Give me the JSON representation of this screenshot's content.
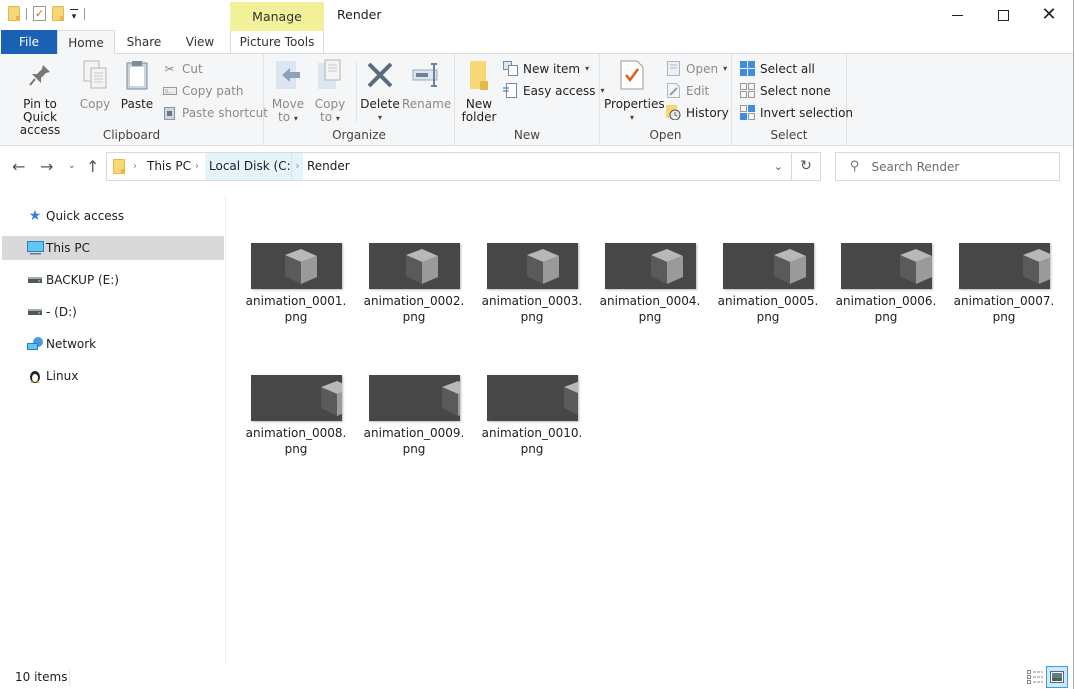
{
  "window": {
    "title": "Render",
    "contextual_tab_group": "Manage",
    "controls": {
      "minimize": "minimize",
      "maximize": "maximize",
      "close": "close"
    }
  },
  "quick_access_toolbar": {
    "items": [
      "folder-icon",
      "properties-icon",
      "new-folder-icon",
      "customize-dropdown"
    ]
  },
  "tabs": [
    {
      "label": "File",
      "active": false
    },
    {
      "label": "Home",
      "active": true
    },
    {
      "label": "Share",
      "active": false
    },
    {
      "label": "View",
      "active": false
    },
    {
      "label": "Picture Tools",
      "active": false
    }
  ],
  "ribbon": {
    "clipboard": {
      "label": "Clipboard",
      "pin": {
        "line1": "Pin to Quick",
        "line2": "access"
      },
      "copy": "Copy",
      "paste": "Paste",
      "cut": "Cut",
      "copy_path": "Copy path",
      "paste_shortcut": "Paste shortcut"
    },
    "organize": {
      "label": "Organize",
      "move_to": {
        "line1": "Move",
        "line2": "to"
      },
      "copy_to": {
        "line1": "Copy",
        "line2": "to"
      },
      "delete": "Delete",
      "rename": "Rename"
    },
    "new": {
      "label": "New",
      "new_folder": {
        "line1": "New",
        "line2": "folder"
      },
      "new_item": "New item",
      "easy_access": "Easy access"
    },
    "open": {
      "label": "Open",
      "properties": "Properties",
      "open": "Open",
      "edit": "Edit",
      "history": "History"
    },
    "select": {
      "label": "Select",
      "select_all": "Select all",
      "select_none": "Select none",
      "invert_selection": "Invert selection"
    }
  },
  "address_bar": {
    "crumbs": [
      "This PC",
      "Local Disk (C:)",
      "Render"
    ],
    "selected_crumb": "Local Disk (C:)"
  },
  "search": {
    "placeholder": "Search Render"
  },
  "nav_pane": {
    "items": [
      {
        "label": "Quick access",
        "icon": "star-icon"
      },
      {
        "label": "This PC",
        "icon": "computer-icon",
        "selected": true
      },
      {
        "label": "BACKUP (E:)",
        "icon": "drive-icon"
      },
      {
        "label": "- (D:)",
        "icon": "drive-icon"
      },
      {
        "label": "Network",
        "icon": "network-icon"
      },
      {
        "label": "Linux",
        "icon": "linux-icon"
      }
    ]
  },
  "files": [
    {
      "name": "animation_0001.png",
      "line1": "animation_0001.",
      "line2": "png",
      "cube_pos": 0.55
    },
    {
      "name": "animation_0002.png",
      "line1": "animation_0002.",
      "line2": "png",
      "cube_pos": 0.58
    },
    {
      "name": "animation_0003.png",
      "line1": "animation_0003.",
      "line2": "png",
      "cube_pos": 0.62
    },
    {
      "name": "animation_0004.png",
      "line1": "animation_0004.",
      "line2": "png",
      "cube_pos": 0.68
    },
    {
      "name": "animation_0005.png",
      "line1": "animation_0005.",
      "line2": "png",
      "cube_pos": 0.74
    },
    {
      "name": "animation_0006.png",
      "line1": "animation_0006.",
      "line2": "png",
      "cube_pos": 0.82
    },
    {
      "name": "animation_0007.png",
      "line1": "animation_0007.",
      "line2": "png",
      "cube_pos": 0.88
    },
    {
      "name": "animation_0008.png",
      "line1": "animation_0008.",
      "line2": "png",
      "cube_pos": 0.94
    },
    {
      "name": "animation_0009.png",
      "line1": "animation_0009.",
      "line2": "png",
      "cube_pos": 0.98
    },
    {
      "name": "animation_0010.png",
      "line1": "animation_0010.",
      "line2": "png",
      "cube_pos": 1.02
    }
  ],
  "status_bar": {
    "item_count": "10 items",
    "view_mode": "large-icons"
  },
  "colors": {
    "file_tab": "#1a61b5",
    "manage_tab": "#f3f09a",
    "selection": "#d9d9d9",
    "thumbnail_bg": "#474747"
  }
}
